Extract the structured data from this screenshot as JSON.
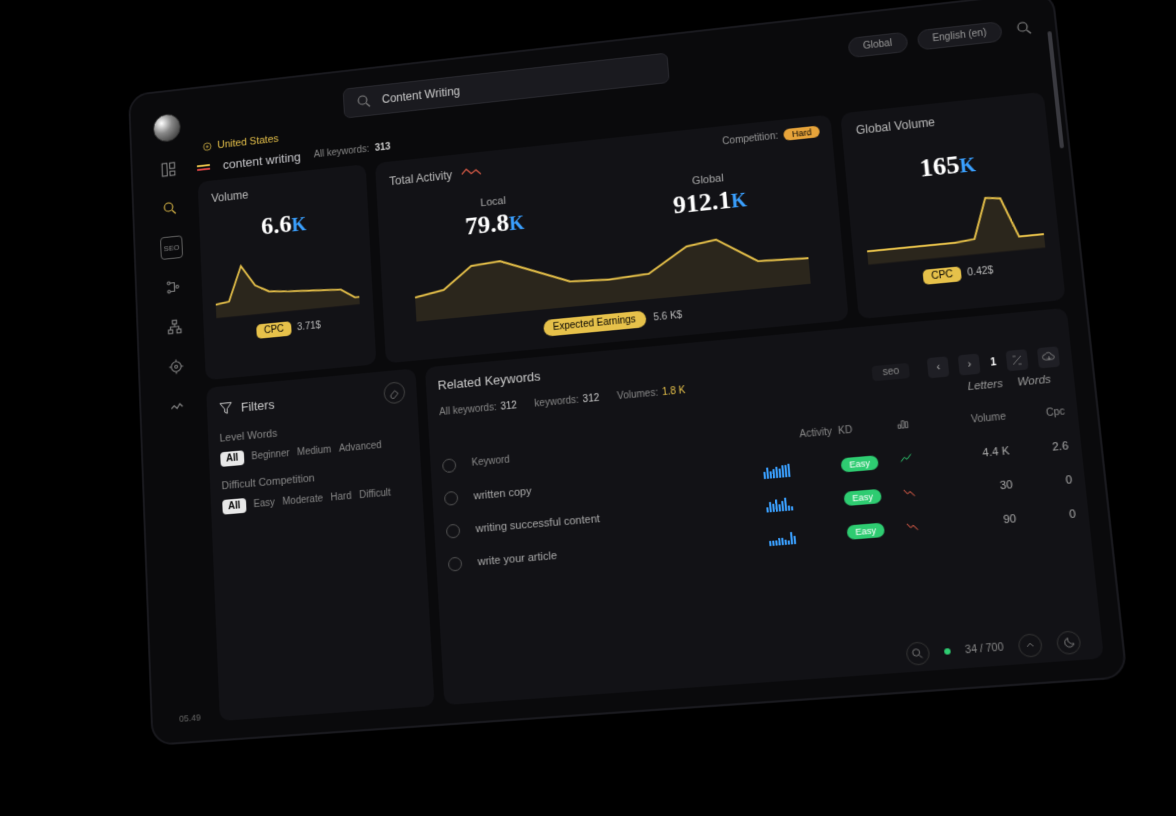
{
  "search": {
    "value": "Content Writing"
  },
  "scope": {
    "region": "Global",
    "language": "English (en)"
  },
  "location": "United States",
  "page": {
    "keyword": "content writing",
    "all_keywords_label": "All keywords:",
    "all_keywords": "313"
  },
  "volume_card": {
    "title": "Volume",
    "value": "6.6",
    "unit": "K",
    "cpc_label": "CPC",
    "cpc": "3.71$"
  },
  "activity_card": {
    "title": "Total Activity",
    "competition_label": "Competition:",
    "competition": "Hard",
    "local_label": "Local",
    "local_value": "79.8",
    "local_unit": "K",
    "global_label": "Global",
    "global_value": "912.1",
    "global_unit": "K",
    "expected_label": "Expected Earnings",
    "expected_value": "5.6 K$"
  },
  "global_card": {
    "title": "Global Volume",
    "value": "165",
    "unit": "K",
    "cpc_label": "CPC",
    "cpc": "0.42$"
  },
  "filters": {
    "title": "Filters",
    "level_title": "Level Words",
    "level_options": [
      "All",
      "Beginner",
      "Medium",
      "Advanced"
    ],
    "diff_title": "Difficult Competition",
    "diff_options": [
      "All",
      "Easy",
      "Moderate",
      "Hard",
      "Difficult"
    ]
  },
  "related": {
    "title": "Related Keywords",
    "all_label": "All keywords:",
    "all_val": "312",
    "kw_label": "keywords:",
    "kw_val": "312",
    "vol_label": "Volumes:",
    "vol_val": "1.8 K",
    "tag": "seo",
    "page": "1",
    "tabs": {
      "letters": "Letters",
      "words": "Words"
    },
    "columns": {
      "keyword": "Keyword",
      "activity": "Activity",
      "kd": "KD",
      "trend": "",
      "volume": "Volume",
      "cpc": "Cpc"
    },
    "rows": [
      {
        "keyword": "written copy",
        "kd": "Easy",
        "trend": "up",
        "volume": "4.4 K",
        "cpc": "2.6"
      },
      {
        "keyword": "writing successful content",
        "kd": "Easy",
        "trend": "down",
        "volume": "30",
        "cpc": "0"
      },
      {
        "keyword": "write your article",
        "kd": "Easy",
        "trend": "down",
        "volume": "90",
        "cpc": "0"
      }
    ]
  },
  "footer": {
    "count": "34 / 700"
  },
  "sidebar": {
    "version": "05.49"
  },
  "chart_data": [
    {
      "type": "line",
      "title": "Volume",
      "x": [
        0,
        1,
        2,
        3,
        4,
        5,
        6,
        7,
        8,
        9
      ],
      "values": [
        20,
        22,
        70,
        40,
        30,
        28,
        26,
        25,
        24,
        10
      ],
      "ylim": [
        0,
        100
      ]
    },
    {
      "type": "line",
      "title": "Total Activity",
      "x": [
        0,
        1,
        2,
        3,
        4,
        5,
        6,
        7,
        8,
        9,
        10,
        11
      ],
      "values": [
        30,
        35,
        55,
        58,
        50,
        35,
        32,
        30,
        32,
        60,
        65,
        30
      ],
      "ylim": [
        0,
        100
      ]
    },
    {
      "type": "line",
      "title": "Global Volume",
      "x": [
        0,
        1,
        2,
        3,
        4,
        5,
        6,
        7,
        8,
        9
      ],
      "values": [
        18,
        18,
        18,
        18,
        18,
        18,
        20,
        75,
        70,
        20
      ],
      "ylim": [
        0,
        100
      ]
    }
  ]
}
